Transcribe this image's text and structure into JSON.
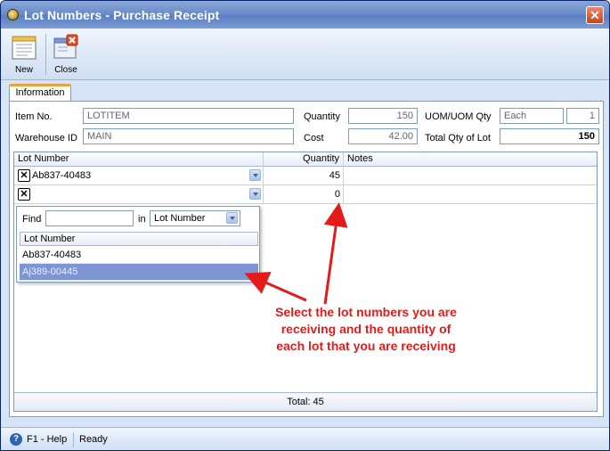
{
  "window": {
    "title": "Lot Numbers - Purchase Receipt",
    "close_glyph": "✕"
  },
  "toolbar": {
    "new_label": "New",
    "close_label": "Close"
  },
  "tabs": [
    {
      "label": "Information"
    }
  ],
  "form": {
    "item_no_label": "Item No.",
    "item_no_value": "LOTITEM",
    "warehouse_label": "Warehouse ID",
    "warehouse_value": "MAIN",
    "quantity_label": "Quantity",
    "quantity_value": "150",
    "cost_label": "Cost",
    "cost_value": "42.00",
    "uom_label": "UOM/UOM Qty",
    "uom_value": "Each",
    "uom_qty_value": "1",
    "total_qty_label": "Total Qty of Lot",
    "total_qty_value": "150"
  },
  "grid": {
    "columns": [
      "Lot Number",
      "Quantity",
      "Notes"
    ],
    "rows": [
      {
        "remove_glyph": "✕",
        "lot_number": "Ab837-40483",
        "quantity": "45",
        "notes": ""
      },
      {
        "remove_glyph": "✕",
        "lot_number": "",
        "quantity": "0",
        "notes": ""
      }
    ],
    "footer": "Total: 45"
  },
  "lot_dropdown": {
    "find_label": "Find",
    "find_value": "",
    "in_label": "in",
    "in_option": "Lot Number",
    "column_header": "Lot Number",
    "options": [
      "Ab837-40483",
      "Aj389-00445"
    ],
    "selected_index": 1
  },
  "annotation": {
    "text": "Select the lot numbers you are receiving and the quantity of each lot that you are receiving",
    "color": "#e31b1b"
  },
  "statusbar": {
    "help_label": "F1 - Help",
    "status": "Ready"
  },
  "colors": {
    "accent": "#7d96d3",
    "title_bar": "#6a8cc9",
    "annotation": "#e31b1b"
  }
}
